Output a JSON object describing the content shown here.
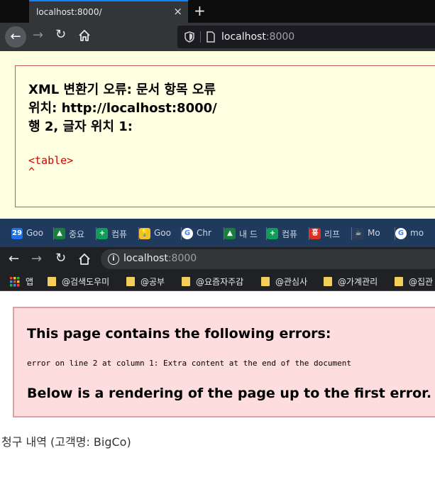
{
  "firefox": {
    "tab_title": "localhost:8000/",
    "tab_close": "×",
    "new_tab": "+",
    "back": "←",
    "forward": "→",
    "reload": "↻",
    "url_host": "localhost",
    "url_port": ":8000",
    "accent_color": "#0a84ff"
  },
  "xml_error": {
    "line1": "XML 변환기 오류: 문서 항목 오류",
    "line2": "위치: http://localhost:8000/",
    "line3": "행 2, 글자 위치 1:",
    "source_line": "<table>",
    "caret": "^",
    "background": "#ffffe2",
    "text_color": "#d40000"
  },
  "chrome": {
    "tabs": [
      {
        "icon": "calendar-icon",
        "icon_text": "29",
        "icon_color": "#1a73e8",
        "label": "Goo"
      },
      {
        "icon": "drive-icon",
        "icon_text": "▲",
        "icon_color": "#188038",
        "label": "중요"
      },
      {
        "icon": "sheets-icon",
        "icon_text": "+",
        "icon_color": "#0f9d58",
        "label": "컴퓨"
      },
      {
        "icon": "keep-icon",
        "icon_text": "💡",
        "icon_color": "#f6bf26",
        "label": "Goo"
      },
      {
        "icon": "google-icon",
        "icon_text": "G",
        "icon_color": "#ffffff",
        "label": "Chr"
      },
      {
        "icon": "drive-icon",
        "icon_text": "▲",
        "icon_color": "#188038",
        "label": "내 드"
      },
      {
        "icon": "sheets-icon",
        "icon_text": "+",
        "icon_color": "#0f9d58",
        "label": "컴퓨"
      },
      {
        "icon": "hong-icon",
        "icon_text": "홍",
        "icon_color": "#d93025",
        "label": "리프"
      },
      {
        "icon": "coffee-icon",
        "icon_text": "☕",
        "icon_color": "#2b3f5c",
        "label": "Mo"
      },
      {
        "icon": "google-icon",
        "icon_text": "G",
        "icon_color": "#ffffff",
        "label": "mo"
      }
    ],
    "back": "←",
    "forward": "→",
    "reload": "↻",
    "url_host": "localhost",
    "url_port": ":8000",
    "bookmarks": [
      {
        "label": "앱",
        "kind": "apps"
      },
      {
        "label": "@검색도우미",
        "kind": "folder"
      },
      {
        "label": "@공부",
        "kind": "folder"
      },
      {
        "label": "@요즘자주감",
        "kind": "folder"
      },
      {
        "label": "@관심사",
        "kind": "folder"
      },
      {
        "label": "@가계관리",
        "kind": "folder"
      },
      {
        "label": "@집관",
        "kind": "folder"
      }
    ]
  },
  "parse_error": {
    "heading": "This page contains the following errors:",
    "message": "error on line 2 at column 1: Extra content at the end of the document",
    "subheading": "Below is a rendering of the page up to the first error."
  },
  "rendered": {
    "caption": "청구 내역 (고객명: BigCo)"
  }
}
